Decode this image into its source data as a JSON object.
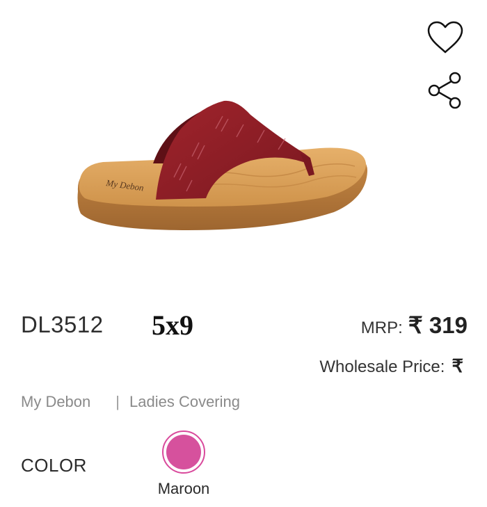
{
  "product": {
    "image_icon": "sandal-product-image",
    "logo_text": "My Debon",
    "sku": "DL3512",
    "size_range": "5x9",
    "mrp_label": "MRP:",
    "mrp_value": "₹ 319",
    "wholesale_label": "Wholesale Price:",
    "wholesale_value": "₹",
    "brand": "My Debon",
    "separator": "|",
    "category": "Ladies Covering"
  },
  "actions": {
    "wishlist_icon": "heart-icon",
    "share_icon": "share-icon"
  },
  "color": {
    "title": "COLOR",
    "selected_name": "Maroon",
    "swatch_hex": "#d6519d",
    "ring_hex": "#d94a9c"
  },
  "colors": {
    "strap": "#8c1c24",
    "footbed": "#d59a50",
    "sole": "#b77a3c"
  }
}
